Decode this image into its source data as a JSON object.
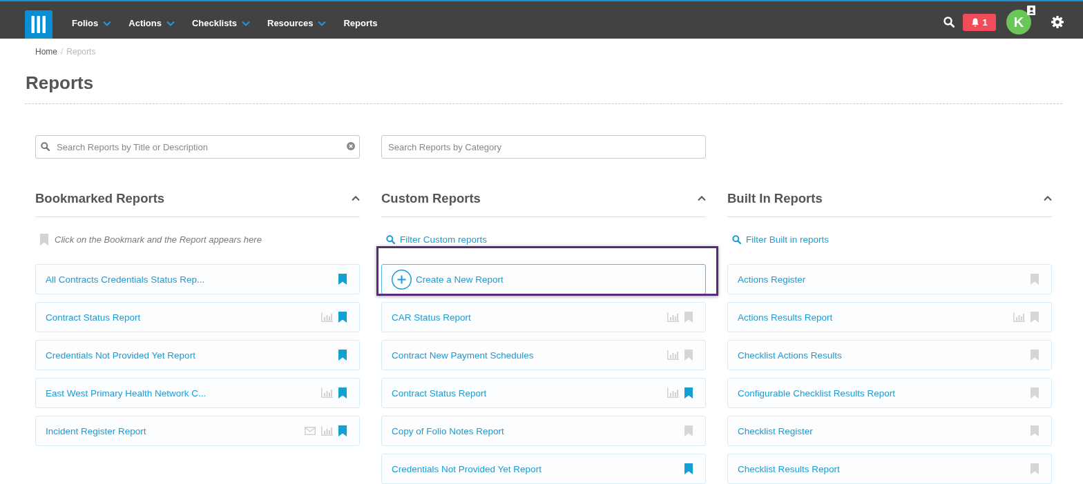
{
  "nav": {
    "items": [
      {
        "label": "Folios",
        "dropdown": true
      },
      {
        "label": "Actions",
        "dropdown": true
      },
      {
        "label": "Checklists",
        "dropdown": true
      },
      {
        "label": "Resources",
        "dropdown": true
      },
      {
        "label": "Reports",
        "dropdown": false
      }
    ],
    "notification_count": "1",
    "avatar_initial": "K"
  },
  "breadcrumb": {
    "separator": "/",
    "items": [
      {
        "label": "Home",
        "current": false
      },
      {
        "label": "Reports",
        "current": true
      }
    ]
  },
  "page_title": "Reports",
  "search": {
    "placeholder": "Search Reports by Title or Description"
  },
  "category_search": {
    "placeholder": "Search Reports by Category"
  },
  "sections": [
    {
      "title": "Bookmarked Reports",
      "expanded": true,
      "empty_hint": "Click on the Bookmark and the Report appears here",
      "reports": [
        {
          "name": "All Contracts Credentials Status Rep...",
          "email": false,
          "chart": false,
          "bookmarked": true
        },
        {
          "name": "Contract Status Report",
          "email": false,
          "chart": true,
          "bookmarked": true
        },
        {
          "name": "Credentials Not Provided Yet Report",
          "email": false,
          "chart": false,
          "bookmarked": true
        },
        {
          "name": "East West Primary Health Network C...",
          "email": false,
          "chart": true,
          "bookmarked": true
        },
        {
          "name": "Incident Register Report",
          "email": true,
          "chart": true,
          "bookmarked": true
        }
      ]
    },
    {
      "title": "Custom Reports",
      "expanded": true,
      "filter": "Filter Custom reports",
      "create": {
        "label": "Create a New Report",
        "highlighted": true
      },
      "reports": [
        {
          "name": "CAR Status Report",
          "email": false,
          "chart": true,
          "bookmarked": false
        },
        {
          "name": "Contract New Payment Schedules",
          "email": false,
          "chart": true,
          "bookmarked": false
        },
        {
          "name": "Contract Status Report",
          "email": false,
          "chart": true,
          "bookmarked": true
        },
        {
          "name": "Copy of Folio Notes Report",
          "email": false,
          "chart": false,
          "bookmarked": false
        },
        {
          "name": "Credentials Not Provided Yet Report",
          "email": false,
          "chart": false,
          "bookmarked": true
        }
      ]
    },
    {
      "title": "Built In Reports",
      "expanded": true,
      "filter": "Filter Built in reports",
      "reports": [
        {
          "name": "Actions Register",
          "email": false,
          "chart": false,
          "bookmarked": false
        },
        {
          "name": "Actions Results Report",
          "email": false,
          "chart": true,
          "bookmarked": false
        },
        {
          "name": "Checklist Actions Results",
          "email": false,
          "chart": false,
          "bookmarked": false
        },
        {
          "name": "Configurable Checklist Results Report",
          "email": false,
          "chart": false,
          "bookmarked": false
        },
        {
          "name": "Checklist Register",
          "email": false,
          "chart": false,
          "bookmarked": false
        },
        {
          "name": "Checklist Results Report",
          "email": false,
          "chart": false,
          "bookmarked": false
        }
      ]
    }
  ]
}
